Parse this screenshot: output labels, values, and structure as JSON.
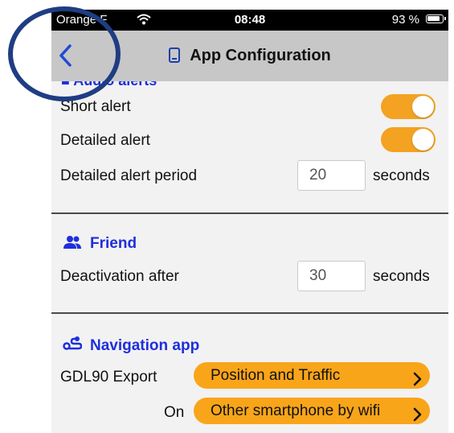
{
  "status_bar": {
    "carrier": "Orange F",
    "time": "08:48",
    "battery": "93 %"
  },
  "nav": {
    "title": "App Configuration"
  },
  "alerts_section": {
    "title_peek": "Audio alerts",
    "short_alert_label": "Short alert",
    "short_alert_on": true,
    "detailed_alert_label": "Detailed alert",
    "detailed_alert_on": true,
    "period_label": "Detailed alert period",
    "period_value": "20",
    "period_unit": "seconds"
  },
  "friend_section": {
    "title": "Friend",
    "deactivation_label": "Deactivation after",
    "deactivation_value": "30",
    "deactivation_unit": "seconds"
  },
  "navigation_section": {
    "title": "Navigation app",
    "gdl_label": "GDL90 Export",
    "gdl_value": "Position and Traffic",
    "on_label": "On",
    "on_value": "Other smartphone by wifi"
  },
  "colors": {
    "accent_orange": "#f9a51a",
    "section_blue": "#1f2fdc",
    "annotation_navy": "#1f3d82"
  }
}
